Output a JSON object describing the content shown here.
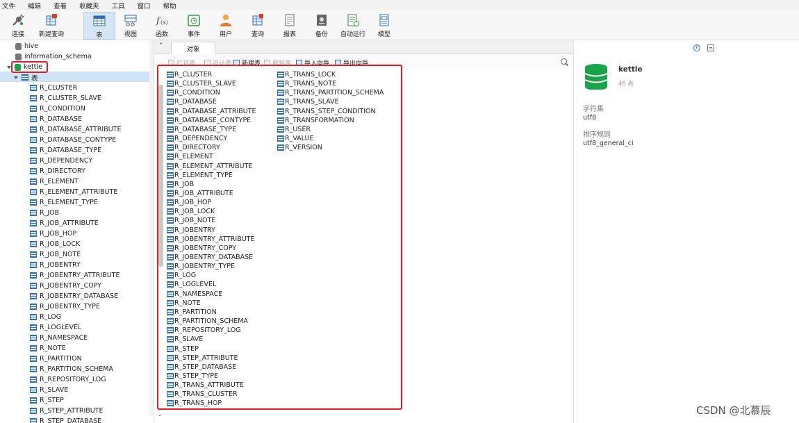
{
  "menu": [
    "文件",
    "编辑",
    "查看",
    "收藏夹",
    "工具",
    "窗口",
    "帮助"
  ],
  "toolbar": [
    {
      "label": "连接",
      "icon": "connect-icon"
    },
    {
      "label": "新建查询",
      "icon": "new-query-icon"
    },
    {
      "label": "表",
      "icon": "table-icon"
    },
    {
      "label": "视图",
      "icon": "view-icon"
    },
    {
      "label": "函数",
      "icon": "function-icon"
    },
    {
      "label": "事件",
      "icon": "event-icon"
    },
    {
      "label": "用户",
      "icon": "user-icon"
    },
    {
      "label": "查询",
      "icon": "query-icon"
    },
    {
      "label": "报表",
      "icon": "report-icon"
    },
    {
      "label": "备份",
      "icon": "backup-icon"
    },
    {
      "label": "自动运行",
      "icon": "auto-run-icon"
    },
    {
      "label": "模型",
      "icon": "model-icon"
    }
  ],
  "sidebar": {
    "databases": [
      "hive",
      "information_schema",
      "kettle"
    ],
    "tables_node": "表",
    "tables": [
      "R_CLUSTER",
      "R_CLUSTER_SLAVE",
      "R_CONDITION",
      "R_DATABASE",
      "R_DATABASE_ATTRIBUTE",
      "R_DATABASE_CONTYPE",
      "R_DATABASE_TYPE",
      "R_DEPENDENCY",
      "R_DIRECTORY",
      "R_ELEMENT",
      "R_ELEMENT_ATTRIBUTE",
      "R_ELEMENT_TYPE",
      "R_JOB",
      "R_JOB_ATTRIBUTE",
      "R_JOB_HOP",
      "R_JOB_LOCK",
      "R_JOB_NOTE",
      "R_JOBENTRY",
      "R_JOBENTRY_ATTRIBUTE",
      "R_JOBENTRY_COPY",
      "R_JOBENTRY_DATABASE",
      "R_JOBENTRY_TYPE",
      "R_LOG",
      "R_LOGLEVEL",
      "R_NAMESPACE",
      "R_NOTE",
      "R_PARTITION",
      "R_PARTITION_SCHEMA",
      "R_REPOSITORY_LOG",
      "R_SLAVE",
      "R_STEP",
      "R_STEP_ATTRIBUTE",
      "R_STEP_DATABASE"
    ]
  },
  "tabs": {
    "objects": "对象"
  },
  "object_toolbar": [
    "打开表",
    "设计表",
    "新建表",
    "删除表",
    "导入向导",
    "导出向导"
  ],
  "objects_col1": [
    "R_CLUSTER",
    "R_CLUSTER_SLAVE",
    "R_CONDITION",
    "R_DATABASE",
    "R_DATABASE_ATTRIBUTE",
    "R_DATABASE_CONTYPE",
    "R_DATABASE_TYPE",
    "R_DEPENDENCY",
    "R_DIRECTORY",
    "R_ELEMENT",
    "R_ELEMENT_ATTRIBUTE",
    "R_ELEMENT_TYPE",
    "R_JOB",
    "R_JOB_ATTRIBUTE",
    "R_JOB_HOP",
    "R_JOB_LOCK",
    "R_JOB_NOTE",
    "R_JOBENTRY",
    "R_JOBENTRY_ATTRIBUTE",
    "R_JOBENTRY_COPY",
    "R_JOBENTRY_DATABASE",
    "R_JOBENTRY_TYPE",
    "R_LOG",
    "R_LOGLEVEL",
    "R_NAMESPACE",
    "R_NOTE",
    "R_PARTITION",
    "R_PARTITION_SCHEMA",
    "R_REPOSITORY_LOG",
    "R_SLAVE",
    "R_STEP",
    "R_STEP_ATTRIBUTE",
    "R_STEP_DATABASE",
    "R_STEP_TYPE",
    "R_TRANS_ATTRIBUTE",
    "R_TRANS_CLUSTER",
    "R_TRANS_HOP"
  ],
  "objects_col2": [
    "R_TRANS_LOCK",
    "R_TRANS_NOTE",
    "R_TRANS_PARTITION_SCHEMA",
    "R_TRANS_SLAVE",
    "R_TRANS_STEP_CONDITION",
    "R_TRANSFORMATION",
    "R_USER",
    "R_VALUE",
    "R_VERSION"
  ],
  "info_panel": {
    "name": "kettle",
    "table_count": "46 表",
    "charset_label": "字符集",
    "charset_value": "utf8",
    "collation_label": "排序规则",
    "collation_value": "utf8_general_ci"
  },
  "watermark": "CSDN @北慕辰",
  "colors": {
    "accent": "#2c6cb3",
    "db_green": "#1aa34a",
    "highlight": "#e8191f",
    "selection": "#cfe3f7"
  }
}
